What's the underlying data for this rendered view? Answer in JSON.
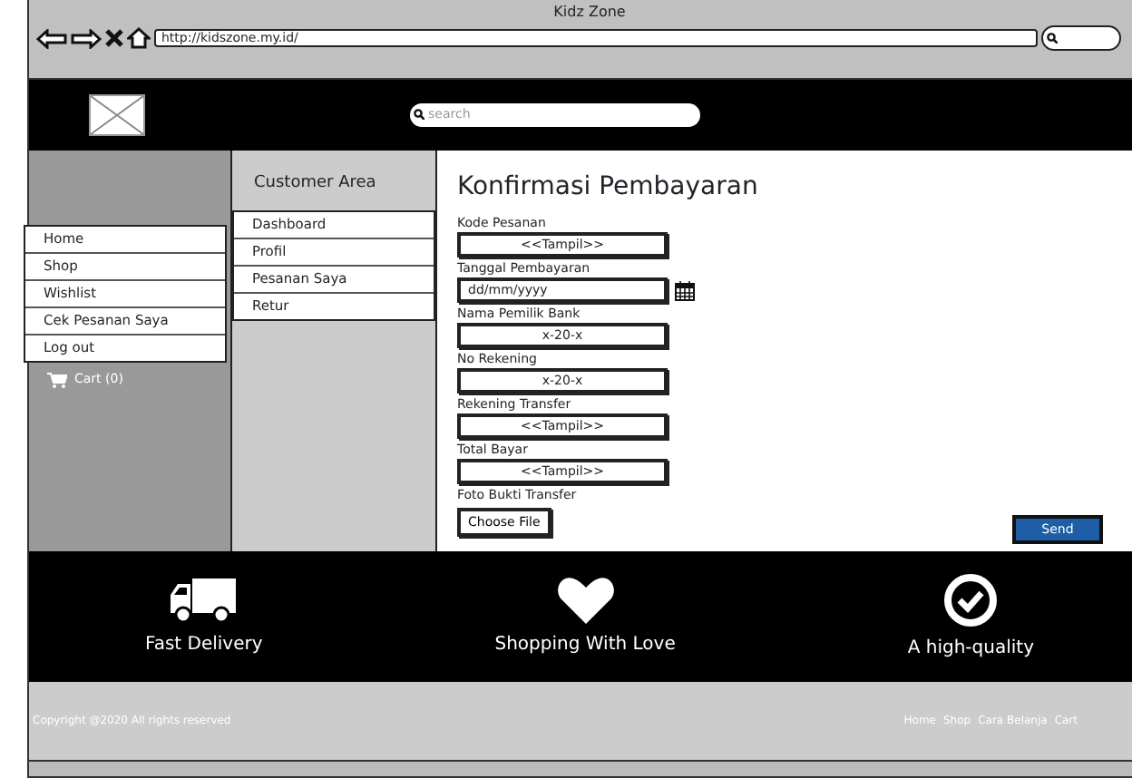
{
  "browser": {
    "title": "Kidz Zone",
    "url": "http://kidszone.my.id/"
  },
  "header": {
    "search_placeholder": "search"
  },
  "sidebar": {
    "menu": [
      "Home",
      "Shop",
      "Wishlist",
      "Cek Pesanan Saya",
      "Log out"
    ],
    "cart": "Cart (0)"
  },
  "customer_area": {
    "title": "Customer Area",
    "menu": [
      "Dashboard",
      "Profil",
      "Pesanan Saya",
      "Retur"
    ]
  },
  "form": {
    "title": "Konfirmasi Pembayaran",
    "fields": [
      {
        "kind": "text",
        "label": "Kode Pesanan",
        "value": "<<Tampil>>"
      },
      {
        "kind": "date",
        "label": "Tanggal Pembayaran",
        "value": "dd/mm/yyyy"
      },
      {
        "kind": "text",
        "label": "Nama Pemilik Bank",
        "value": "x-20-x"
      },
      {
        "kind": "text",
        "label": "No Rekening",
        "value": "x-20-x"
      },
      {
        "kind": "text",
        "label": "Rekening Transfer",
        "value": "<<Tampil>>"
      },
      {
        "kind": "text",
        "label": "Total Bayar",
        "value": "<<Tampil>>"
      },
      {
        "kind": "file",
        "label": "Foto Bukti Transfer",
        "value": "Choose File"
      }
    ],
    "submit": "Send"
  },
  "features": [
    {
      "kind": "truck",
      "label": "Fast Delivery"
    },
    {
      "kind": "heart",
      "label": "Shopping With Love"
    },
    {
      "kind": "check",
      "label": "A high-quality"
    }
  ],
  "footer": {
    "copyright": "Copyright @2020 All rights reserved",
    "links": [
      "Home",
      "Shop",
      "Cara Belanja",
      "Cart"
    ]
  }
}
